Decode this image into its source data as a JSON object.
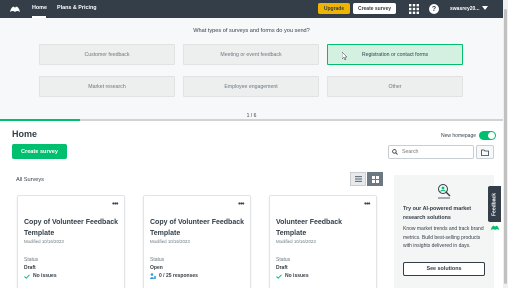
{
  "topbar": {
    "logo": "surveymonkey-logo-icon",
    "nav": [
      {
        "label": "Home",
        "active": true
      },
      {
        "label": "Plans & Pricing",
        "active": false
      }
    ],
    "upgrade_label": "Upgrade",
    "create_survey_label": "Create survey",
    "apps_icon": "grid-icon",
    "help_icon": "help-icon",
    "help_glyph": "?",
    "user_name": "swasrey20...",
    "accent": "#f0b400",
    "bar_color": "#333e48"
  },
  "survey_panel": {
    "question": "What types of surveys and forms do you send?",
    "options": [
      {
        "label": "Customer feedback",
        "selected": false
      },
      {
        "label": "Meeting or event feedback",
        "selected": false
      },
      {
        "label": "Registration or contact forms",
        "selected": true
      },
      {
        "label": "Market research",
        "selected": false
      },
      {
        "label": "Employee engagement",
        "selected": false
      },
      {
        "label": "Other",
        "selected": false
      }
    ],
    "progress_text": "1 / 6",
    "progress_fraction": 0.16
  },
  "home": {
    "title": "Home",
    "new_homepage_label": "New homepage",
    "new_homepage_on": true,
    "create_survey_label": "Create survey",
    "search_placeholder": "Search",
    "all_surveys_label": "All Surveys",
    "view_mode": "grid"
  },
  "cards": [
    {
      "title": "Copy of Volunteer Feedback Template",
      "modified": "Modified 10/16/2023",
      "status_label": "Status",
      "status": "Draft",
      "meta_icon": "check-icon",
      "meta": "No issues"
    },
    {
      "title": "Copy of Volunteer Feedback Template",
      "modified": "Modified 10/16/2023",
      "status_label": "Status",
      "status": "Open",
      "meta_icon": "responses-icon",
      "meta": "0 / 25 responses"
    },
    {
      "title": "Volunteer Feedback Template",
      "modified": "Modified 10/16/2023",
      "status_label": "Status",
      "status": "Draft",
      "meta_icon": "check-icon",
      "meta": "No issues"
    }
  ],
  "promo": {
    "icon": "ai-research-icon",
    "title": "Try our AI-powered market research solutions",
    "body": "Know market trends and track brand metrics. Build best-selling products with insights delivered in days.",
    "button_label": "See solutions"
  },
  "feedback_tab": {
    "label": "Feedback"
  },
  "colors": {
    "brand_green": "#00bf6f",
    "selected_bg": "#d3f0e0",
    "text": "#333e48"
  }
}
